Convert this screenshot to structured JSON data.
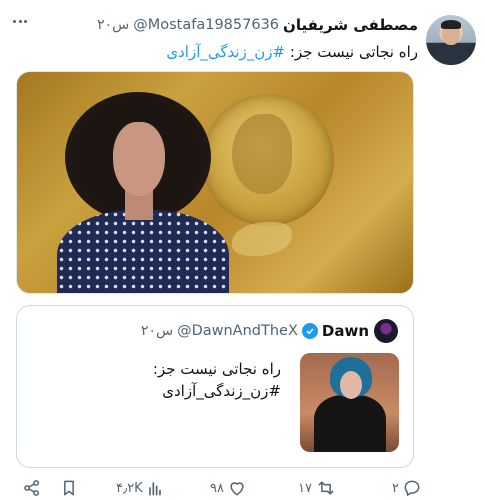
{
  "tweet": {
    "display_name": "مصطفی شریفیان",
    "handle": "@Mostafa19857636",
    "time": "۲۰س",
    "text_prefix": "راه نجاتی نیست جز: ",
    "hashtag": "#زن_زندگی_آزادی"
  },
  "quote": {
    "display_name": "Dawn",
    "handle": "@DawnAndTheX",
    "time": "۲۰س",
    "line1": "راه نجاتی نیست جز:",
    "line2": "#زن_زندگی_آزادی"
  },
  "actions": {
    "replies": "۲",
    "retweets": "۱۷",
    "likes": "۹۸",
    "views": "۴٫۲K"
  },
  "icons": {
    "reply": "reply-icon",
    "retweet": "retweet-icon",
    "like": "heart-icon",
    "views": "views-icon",
    "bookmark": "bookmark-icon",
    "share": "share-icon",
    "more": "more-icon",
    "verified": "verified-badge-icon"
  },
  "colors": {
    "link": "#1d9bf0",
    "secondary_text": "#536471",
    "border": "#cfd9de"
  }
}
